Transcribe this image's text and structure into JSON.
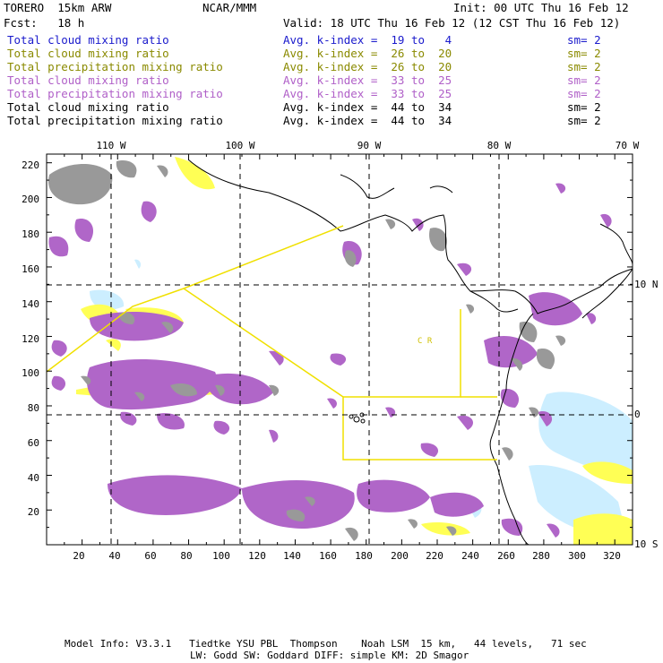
{
  "header": {
    "model": "TORERO  15km ARW",
    "org": "NCAR/MMM",
    "init": "Init: 00 UTC Thu 16 Feb 12",
    "fcst": "Fcst:   18 h",
    "valid": "Valid: 18 UTC Thu 16 Feb 12 (12 CST Thu 16 Feb 12)"
  },
  "legend_rows": [
    {
      "field": "Total cloud mixing ratio",
      "kindex": "Avg. k-index =  19 to   4",
      "sm": "sm= 2",
      "color": "#1a1acc"
    },
    {
      "field": "Total cloud mixing ratio",
      "kindex": "Avg. k-index =  26 to  20",
      "sm": "sm= 2",
      "color": "#8a8a00"
    },
    {
      "field": "Total precipitation mixing ratio",
      "kindex": "Avg. k-index =  26 to  20",
      "sm": "sm= 2",
      "color": "#8a8a00"
    },
    {
      "field": "Total cloud mixing ratio",
      "kindex": "Avg. k-index =  33 to  25",
      "sm": "sm= 2",
      "color": "#b060c8"
    },
    {
      "field": "Total precipitation mixing ratio",
      "kindex": "Avg. k-index =  33 to  25",
      "sm": "sm= 2",
      "color": "#b060c8"
    },
    {
      "field": "Total cloud mixing ratio",
      "kindex": "Avg. k-index =  44 to  34",
      "sm": "sm= 2",
      "color": "#000000"
    },
    {
      "field": "Total precipitation mixing ratio",
      "kindex": "Avg. k-index =  44 to  34",
      "sm": "sm= 2",
      "color": "#000000"
    }
  ],
  "map": {
    "grid_x_range": [
      0,
      330
    ],
    "grid_y_range": [
      0,
      225
    ],
    "x_ticks": [
      "20",
      "40",
      "60",
      "80",
      "100",
      "120",
      "140",
      "160",
      "180",
      "200",
      "220",
      "240",
      "260",
      "280",
      "300",
      "320"
    ],
    "y_ticks": [
      "20",
      "40",
      "60",
      "80",
      "100",
      "120",
      "140",
      "160",
      "180",
      "200",
      "220"
    ],
    "lon_labels": [
      "110 W",
      "100 W",
      "90 W",
      "80 W",
      "70 W"
    ],
    "lat_labels": [
      "10 N",
      "0",
      "10 S"
    ],
    "region_label": "C R",
    "colors": {
      "gray": "#999999",
      "purple": "#b066c8",
      "yellow": "#ffff55",
      "lightblue": "#cceeff",
      "outline_yellow": "#f0e000",
      "coast": "#000000"
    }
  },
  "footer": {
    "line1": "Model Info: V3.3.1   Tiedtke YSU PBL  Thompson    Noah LSM  15 km,   44 levels,   71 sec",
    "line2": "LW: Godd SW: Goddard DIFF: simple KM: 2D Smagor"
  }
}
